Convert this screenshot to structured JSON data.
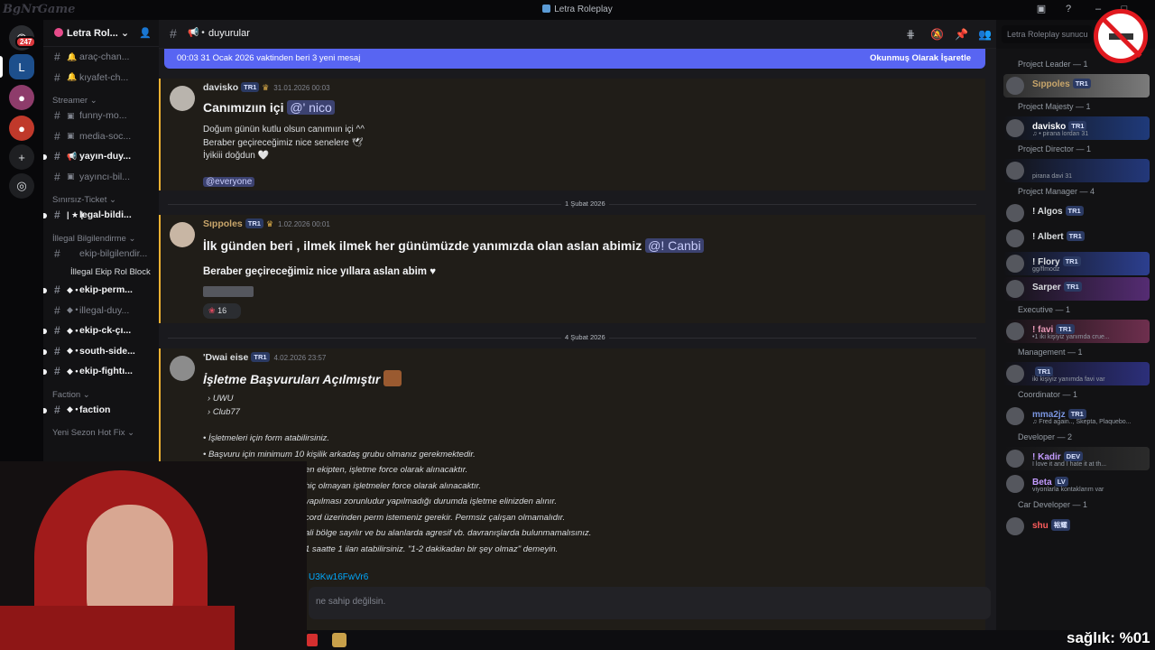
{
  "watermark": "BgNrGame",
  "window": {
    "title": "Letra Roleplay"
  },
  "rail": {
    "dm_badge": "247"
  },
  "guild": {
    "name": "Letra Rol..."
  },
  "channels": [
    {
      "type": "ch",
      "emoji": "🔔",
      "label": "araç-chan..."
    },
    {
      "type": "ch",
      "emoji": "🔔",
      "label": "kıyafet-ch..."
    },
    {
      "type": "cat",
      "label": "Streamer ⌄"
    },
    {
      "type": "ch",
      "emoji": "▣",
      "label": "funny-mo..."
    },
    {
      "type": "ch",
      "emoji": "▣",
      "label": "media-soc..."
    },
    {
      "type": "ch",
      "emoji": "📢",
      "label": "yayın-duy...",
      "bright": true
    },
    {
      "type": "ch",
      "emoji": "▣",
      "label": "yayıncı-bil..."
    },
    {
      "type": "cat",
      "label": "Sınırsız-Ticket ⌄"
    },
    {
      "type": "ch",
      "emoji": "| ★ |",
      "label": "legal-bildi...",
      "bright": true
    },
    {
      "type": "cat",
      "label": "İllegal Bilgilendirme ⌄"
    },
    {
      "type": "ch",
      "emoji": "",
      "label": "ekip-bilgilendir..."
    },
    {
      "type": "sub",
      "label": "İllegal Ekip Rol Block"
    },
    {
      "type": "ch",
      "emoji": "◆ •",
      "label": "ekip-perm...",
      "bright": true
    },
    {
      "type": "ch",
      "emoji": "◆ •",
      "label": "illegal-duy..."
    },
    {
      "type": "ch",
      "emoji": "◆ •",
      "label": "ekip-ck-çı...",
      "bright": true
    },
    {
      "type": "ch",
      "emoji": "◆ •",
      "label": "south-side...",
      "bright": true
    },
    {
      "type": "ch",
      "emoji": "◆ •",
      "label": "ekip-fightı...",
      "bright": true
    },
    {
      "type": "cat",
      "label": "Faction ⌄"
    },
    {
      "type": "ch",
      "emoji": "◆ •",
      "label": "faction",
      "bright": true
    },
    {
      "type": "cat",
      "label": "Yeni Sezon Hot Fix ⌄"
    }
  ],
  "header": {
    "channel": "duyurular",
    "search_placeholder": "Letra Roleplay sunucu"
  },
  "newbar": {
    "text": "00:03 31 Ocak 2026 vaktinden beri 3 yeni mesaj",
    "mark": "Okunmuş Olarak İşaretle"
  },
  "messages": [
    {
      "author": "davisko",
      "tag": "TR1",
      "time": "31.01.2026 00:03",
      "name_color": "#dbdee1",
      "title": "Canımızıın içi",
      "title_mention": "@' nico",
      "lines": [
        "Doğum günün kutlu olsun canımıın içi ^^",
        "Beraber geçireceğimiz nice senelere 🕊",
        "İyikiii doğdun 🤍"
      ],
      "footer_mention": "@everyone"
    },
    {
      "author": "Sıppoles",
      "tag": "TR1",
      "time": "1.02.2026 00:01",
      "name_color": "#c9a66b",
      "title": "İlk günden beri , ilmek ilmek her günümüzde yanımızda olan aslan abimiz",
      "title_mention": "@! Canbi",
      "line2": "Beraber geçireceğimiz nice yıllara aslan abim ♥",
      "reaction_count": "16"
    },
    {
      "author": "'Dwai    eise",
      "tag": "TR1",
      "time": "4.02.2026 23:57",
      "name_color": "#dbdee1",
      "title": "İşletme Başvuruları Açılmıştır",
      "sub": [
        "UWU",
        "Club77"
      ],
      "bullets": [
        "İşletmeleri için form atabilirsiniz.",
        "Başvuru için minimum 10 kişilik arkadaş grubu olmanız gerekmektedir.",
        "en ekipten, işletme force olarak alınacaktır.",
        "hiç olmayan işletmeler force olarak alınacaktır.",
        "yapılması zorunludur yapılmadığı durumda işletme elinizden alınır.",
        "cord üzerinden perm istemeniz gerekir. Permsiz çalışan olmamalıdır.",
        "ali bölge sayılır ve bu alanlarda agresif vb. davranışlarda bulunmamalısınız.",
        "1 saatte 1 ilan atabilirsiniz. \"1-2 dakikadan bir şey olmaz\" demeyin."
      ],
      "link": "U3Kw16FwVr6"
    }
  ],
  "dates": [
    "1 Şubat 2026",
    "4 Şubat 2026"
  ],
  "input_placeholder": "ne sahip değilsin.",
  "members": {
    "groups": [
      {
        "role": "Project Leader — 1",
        "people": [
          {
            "name": "Sıppoles",
            "tag": "TR1",
            "status": "",
            "color": "#c9a66b",
            "bg": "linear-gradient(90deg,#2b2b2b,#7b7b7b)"
          }
        ]
      },
      {
        "role": "Project Majesty — 1",
        "people": [
          {
            "name": "davisko",
            "tag": "TR1",
            "status": "♫ • pirana lordan 31",
            "color": "#ffffff",
            "bg": "linear-gradient(90deg,#121214,#1f3a7a)"
          }
        ]
      },
      {
        "role": "Project Director — 1",
        "people": [
          {
            "name": "",
            "tag": "",
            "status": "pirana davi 31",
            "color": "#ffffff",
            "bg": "linear-gradient(90deg,#121214,#23387a)"
          }
        ]
      },
      {
        "role": "Project Manager — 4",
        "people": [
          {
            "name": "! Algos",
            "tag": "TR1",
            "status": "",
            "color": "#dbdee1",
            "bg": "none"
          },
          {
            "name": "! Albert",
            "tag": "TR1",
            "status": "",
            "color": "#dbdee1",
            "bg": "none"
          },
          {
            "name": "! Flory",
            "tag": "TR1",
            "status": "gg/flmodz",
            "color": "#dbdee1",
            "bg": "linear-gradient(90deg,#121214,#2c3f8f)"
          },
          {
            "name": "Sarper",
            "tag": "TR1",
            "status": "",
            "color": "#dbdee1",
            "bg": "linear-gradient(90deg,#121214,#552c73)"
          }
        ]
      },
      {
        "role": "Executive — 1",
        "people": [
          {
            "name": "! favi",
            "tag": "TR1",
            "status": "•1 iki kişiyiz yanımda crue...",
            "color": "#e89ab8",
            "bg": "linear-gradient(90deg,#121214,#6e2f4e)"
          }
        ]
      },
      {
        "role": "Management — 1",
        "people": [
          {
            "name": "",
            "tag": "TR1",
            "status": "iki kişiyiz yanımda favi var",
            "color": "#dbdee1",
            "bg": "linear-gradient(90deg,#121214,#2c2f7a)"
          }
        ]
      },
      {
        "role": "Coordinator — 1",
        "people": [
          {
            "name": "mma2jz",
            "tag": "TR1",
            "status": "♫ Fred again.., Skepta, Plaquebo...",
            "color": "#7a95e0",
            "bg": "none"
          }
        ]
      },
      {
        "role": "Developer — 2",
        "people": [
          {
            "name": "! Kadir",
            "tag": "DEV",
            "status": "I love it and I hate it at th...",
            "color": "#c39bff",
            "bg": "linear-gradient(90deg,#121214,#2b2b2b)"
          },
          {
            "name": "Beta",
            "tag": "LV",
            "status": "viyonlarla kontaklarım var",
            "color": "#c39bff",
            "bg": "none"
          }
        ]
      },
      {
        "role": "Car Developer — 1",
        "people": [
          {
            "name": "shu",
            "tag": "裕耀",
            "status": "",
            "color": "#ff5d5d",
            "bg": "none"
          }
        ]
      }
    ]
  },
  "overlay": {
    "saglik": "sağlık: %01"
  },
  "colors": {
    "accent": "#5865f2",
    "highlight_border": "#f0b232",
    "mention_bg": "#3c4270"
  }
}
